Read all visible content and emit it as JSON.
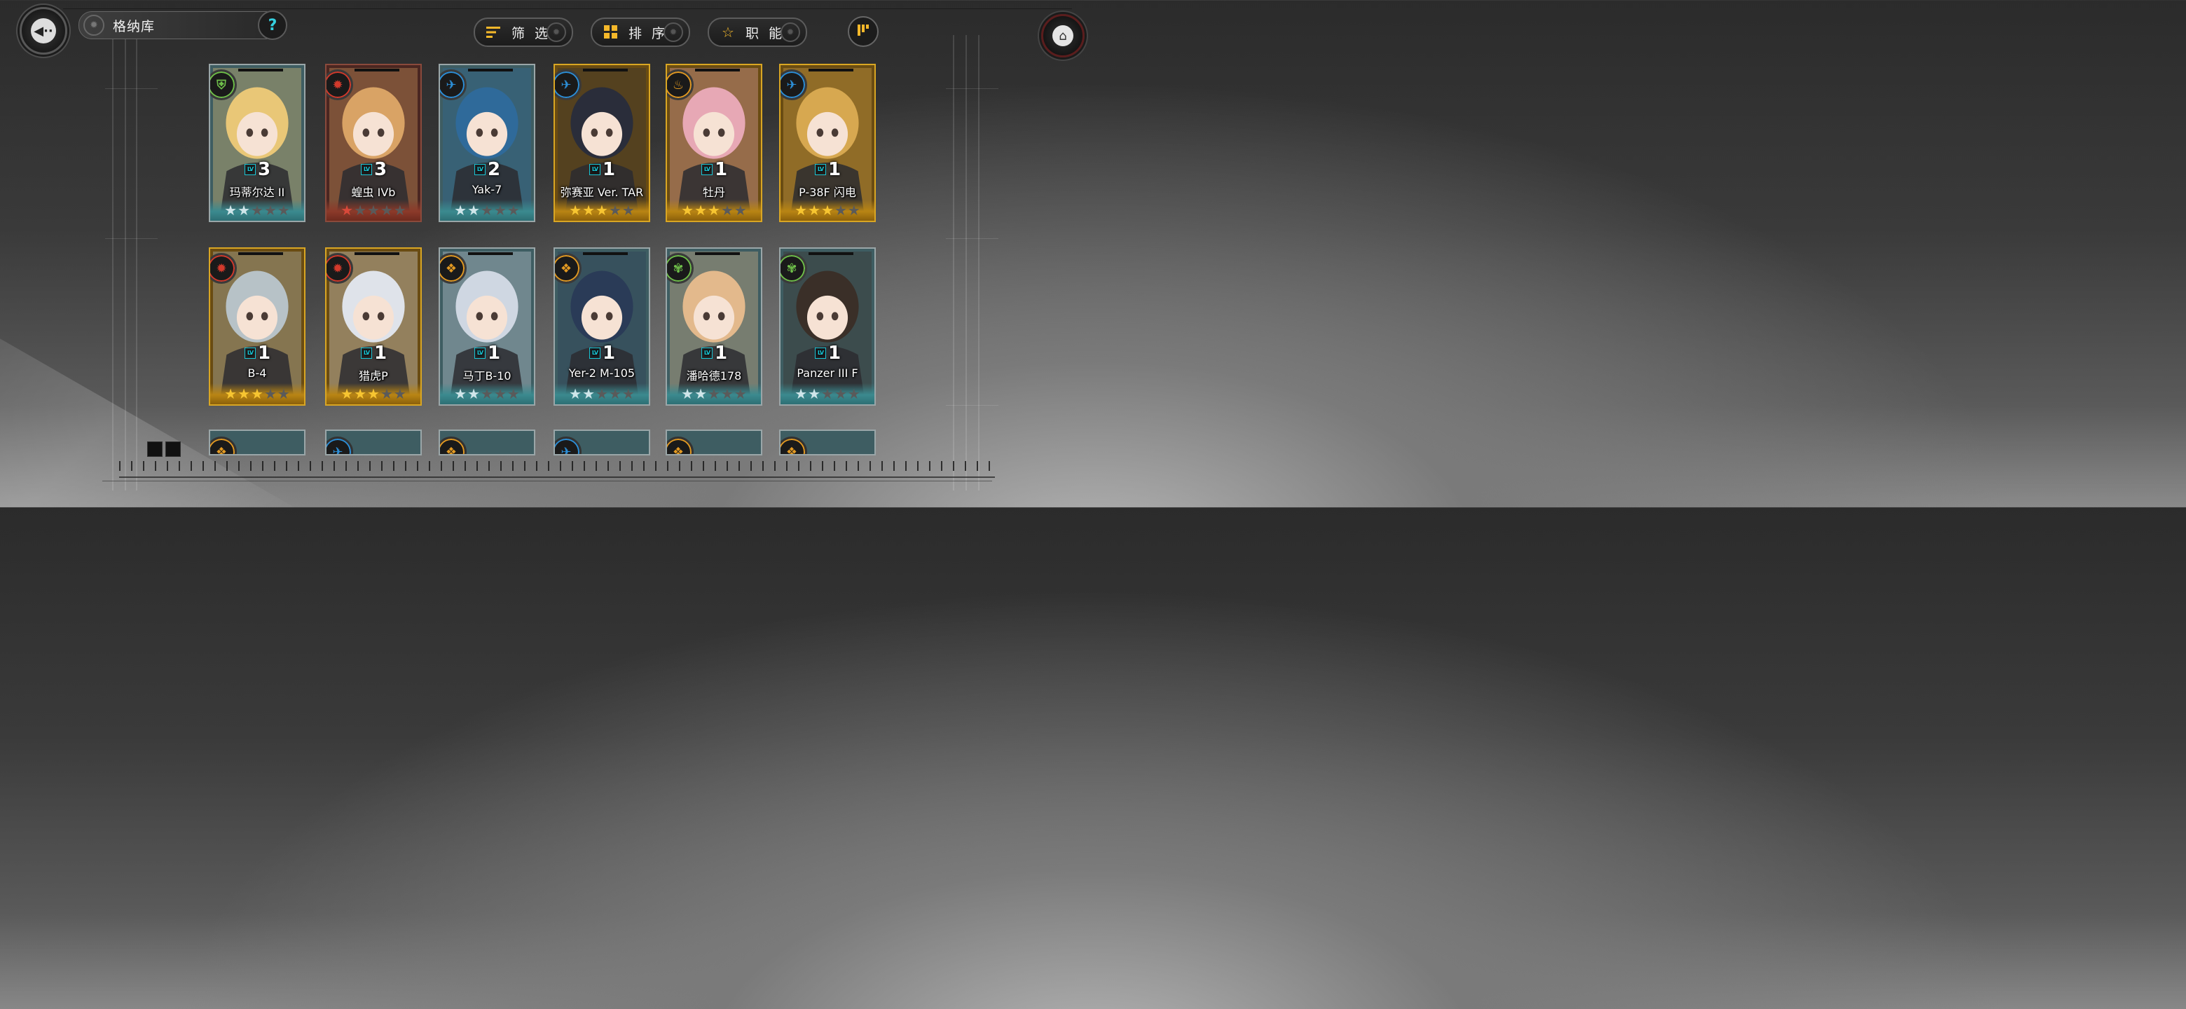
{
  "header": {
    "title": "格纳库",
    "help_symbol": "?",
    "filter_label": "筛 选",
    "sort_label": "排 序",
    "role_label": "职 能"
  },
  "colors": {
    "accent": "#f5b82a",
    "lv_tag": "#19c6d6",
    "star_gold": "#f7c531",
    "star_silver": "#cfe6ea",
    "star_red": "#d8493a",
    "star_empty": "#5a5a5a"
  },
  "icons": {
    "back": "back-arrow-icon",
    "help": "question-icon",
    "filter": "filter-lines-icon",
    "sort": "grid-squares-icon",
    "role": "star-outline-icon",
    "order": "sort-order-icon",
    "home": "home-icon"
  },
  "cards": [
    {
      "name": "玛蒂尔达 II",
      "level": "3",
      "rarity": "silver",
      "stars": 2,
      "role_icon": "shield-icon",
      "role_color": "#6fbf4a",
      "portrait": "#e9c777"
    },
    {
      "name": "蝗虫 IVb",
      "level": "3",
      "rarity": "red",
      "stars": 1,
      "role_icon": "gear-burst-icon",
      "role_color": "#d33a2c",
      "portrait": "#d9a365"
    },
    {
      "name": "Yak-7",
      "level": "2",
      "rarity": "silver",
      "stars": 2,
      "role_icon": "plane-icon",
      "role_color": "#2c8fd8",
      "portrait": "#2f6a9a"
    },
    {
      "name": "弥赛亚 Ver. TAR",
      "level": "1",
      "rarity": "gold",
      "stars": 3,
      "role_icon": "plane-icon",
      "role_color": "#2c8fd8",
      "portrait": "#2a2d3a"
    },
    {
      "name": "牡丹",
      "level": "1",
      "rarity": "gold",
      "stars": 3,
      "role_icon": "flame-icon",
      "role_color": "#e39a22",
      "portrait": "#e7a8b5"
    },
    {
      "name": "P-38F 闪电",
      "level": "1",
      "rarity": "gold",
      "stars": 3,
      "role_icon": "plane-icon",
      "role_color": "#2c8fd8",
      "portrait": "#d7a850"
    },
    {
      "name": "B-4",
      "level": "1",
      "rarity": "gold",
      "stars": 3,
      "role_icon": "gear-burst-icon",
      "role_color": "#d33a2c",
      "portrait": "#b7c2c7"
    },
    {
      "name": "猎虎P",
      "level": "1",
      "rarity": "gold",
      "stars": 3,
      "role_icon": "gear-burst-icon",
      "role_color": "#d33a2c",
      "portrait": "#dfe3ea"
    },
    {
      "name": "马丁B-10",
      "level": "1",
      "rarity": "silver",
      "stars": 2,
      "role_icon": "bomb-icon",
      "role_color": "#e39a22",
      "portrait": "#cfd7e2"
    },
    {
      "name": "Yer-2 M-105",
      "level": "1",
      "rarity": "silver",
      "stars": 2,
      "role_icon": "bomb-icon",
      "role_color": "#e39a22",
      "portrait": "#2a3b57"
    },
    {
      "name": "潘哈德178",
      "level": "1",
      "rarity": "silver",
      "stars": 2,
      "role_icon": "leaf-icon",
      "role_color": "#6fbf4a",
      "portrait": "#e3b98c"
    },
    {
      "name": "Panzer III F",
      "level": "1",
      "rarity": "silver",
      "stars": 2,
      "role_icon": "leaf-icon",
      "role_color": "#6fbf4a",
      "portrait": "#3a2f28"
    }
  ],
  "partial_row_icons": [
    "bomb-icon",
    "plane-icon",
    "bomb-icon",
    "plane-icon",
    "bomb-icon",
    "bomb-icon"
  ]
}
